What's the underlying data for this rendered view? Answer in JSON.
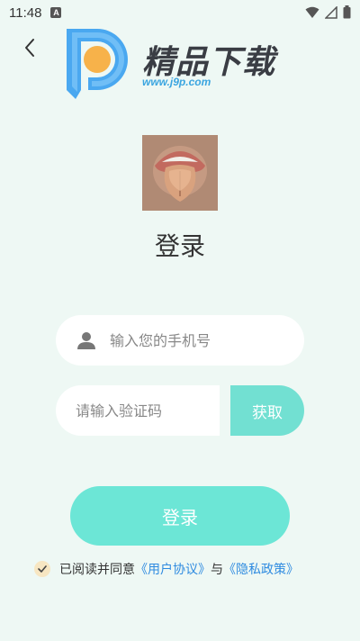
{
  "status_bar": {
    "time": "11:48",
    "indicator": "A"
  },
  "header": {
    "back_icon": "chevron-left-icon",
    "logo": {
      "title": "精品下载",
      "subtitle": "www.j9p.com"
    }
  },
  "app": {
    "avatar_icon": "mouth-tongue-image"
  },
  "page": {
    "title": "登录"
  },
  "form": {
    "phone": {
      "placeholder": "输入您的手机号",
      "value": "",
      "icon": "user-icon"
    },
    "code": {
      "placeholder": "请输入验证码",
      "value": ""
    },
    "get_code_label": "获取",
    "login_label": "登录"
  },
  "agreement": {
    "prefix": "已阅读并同意",
    "user_agreement": "《用户协议》",
    "and": "与",
    "privacy_policy": "《隐私政策》",
    "checked": true
  },
  "colors": {
    "background": "#eef8f4",
    "accent": "#6ce6d6",
    "link": "#2f8be0",
    "logo_blue": "#4aa8f0",
    "logo_orange": "#f7b24a"
  }
}
